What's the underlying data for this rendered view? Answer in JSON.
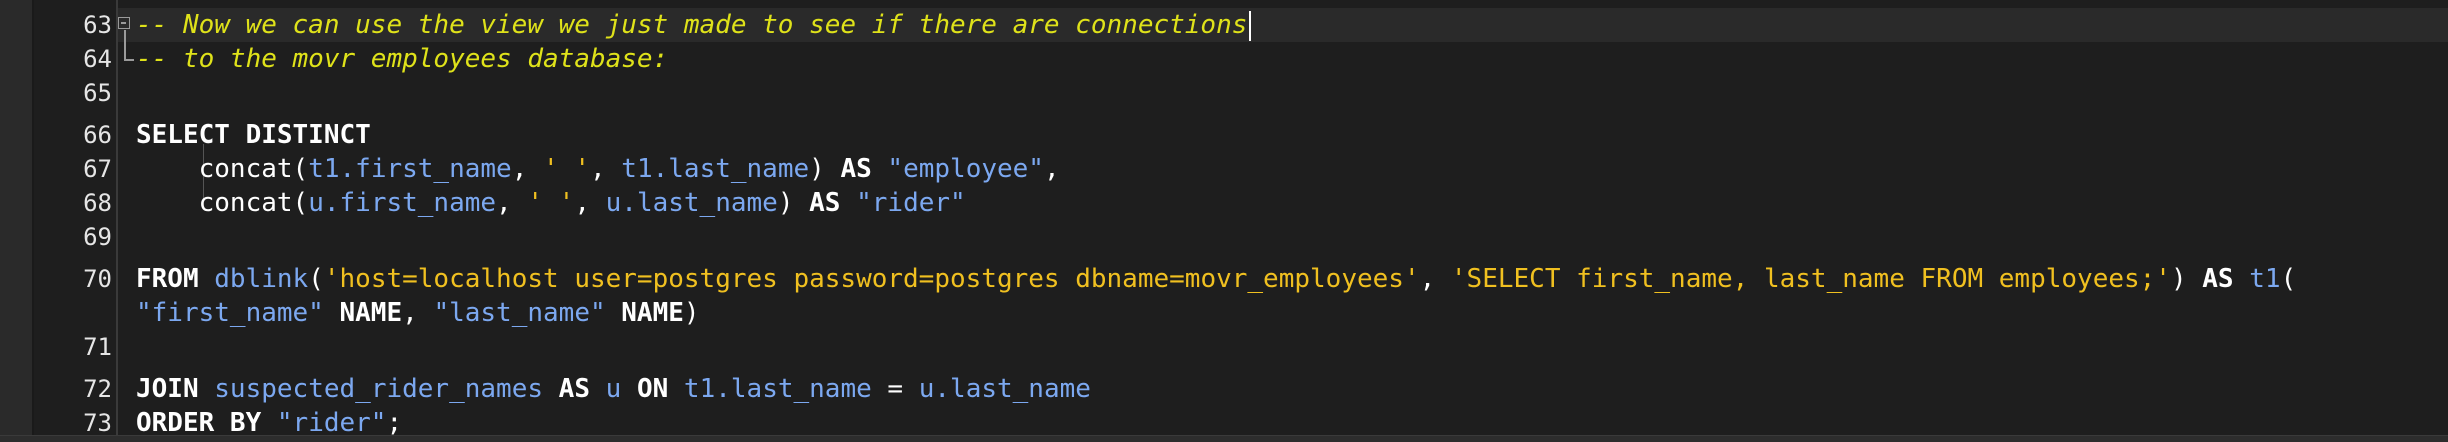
{
  "editor": {
    "lines": [
      {
        "no": "63",
        "segments": [
          {
            "t": "cm",
            "v": "-- Now we can use the view we just made to see if there are connections"
          }
        ]
      },
      {
        "no": "64",
        "segments": [
          {
            "t": "cm",
            "v": "-- to the movr employees database:"
          }
        ]
      },
      {
        "no": "65",
        "segments": []
      },
      {
        "no": "66",
        "segments": [
          {
            "t": "kw",
            "v": "SELECT DISTINCT"
          }
        ]
      },
      {
        "no": "67",
        "segments": [
          {
            "t": "pn",
            "v": "    "
          },
          {
            "t": "fn",
            "v": "concat"
          },
          {
            "t": "pn",
            "v": "("
          },
          {
            "t": "id",
            "v": "t1.first_name"
          },
          {
            "t": "pn",
            "v": ", "
          },
          {
            "t": "str",
            "v": "' '"
          },
          {
            "t": "pn",
            "v": ", "
          },
          {
            "t": "id",
            "v": "t1.last_name"
          },
          {
            "t": "pn",
            "v": ") "
          },
          {
            "t": "kw",
            "v": "AS "
          },
          {
            "t": "qid",
            "v": "\"employee\""
          },
          {
            "t": "pn",
            "v": ","
          }
        ]
      },
      {
        "no": "68",
        "segments": [
          {
            "t": "pn",
            "v": "    "
          },
          {
            "t": "fn",
            "v": "concat"
          },
          {
            "t": "pn",
            "v": "("
          },
          {
            "t": "id",
            "v": "u.first_name"
          },
          {
            "t": "pn",
            "v": ", "
          },
          {
            "t": "str",
            "v": "' '"
          },
          {
            "t": "pn",
            "v": ", "
          },
          {
            "t": "id",
            "v": "u.last_name"
          },
          {
            "t": "pn",
            "v": ") "
          },
          {
            "t": "kw",
            "v": "AS "
          },
          {
            "t": "qid",
            "v": "\"rider\""
          }
        ]
      },
      {
        "no": "69",
        "segments": []
      },
      {
        "no": "70",
        "segments": [
          {
            "t": "kw",
            "v": "FROM "
          },
          {
            "t": "id",
            "v": "dblink"
          },
          {
            "t": "pn",
            "v": "("
          },
          {
            "t": "str",
            "v": "'host=localhost user=postgres password=postgres dbname=movr_employees'"
          },
          {
            "t": "pn",
            "v": ", "
          },
          {
            "t": "str",
            "v": "'SELECT first_name, last_name FROM employees;'"
          },
          {
            "t": "pn",
            "v": ") "
          },
          {
            "t": "kw",
            "v": "AS "
          },
          {
            "t": "id",
            "v": "t1"
          },
          {
            "t": "pn",
            "v": "("
          }
        ]
      },
      {
        "no": "",
        "segments": [
          {
            "t": "qid",
            "v": "\"first_name\""
          },
          {
            "t": "kw",
            "v": " NAME"
          },
          {
            "t": "pn",
            "v": ", "
          },
          {
            "t": "qid",
            "v": "\"last_name\""
          },
          {
            "t": "kw",
            "v": " NAME"
          },
          {
            "t": "pn",
            "v": ")"
          }
        ]
      },
      {
        "no": "71",
        "segments": []
      },
      {
        "no": "72",
        "segments": [
          {
            "t": "kw",
            "v": "JOIN "
          },
          {
            "t": "id",
            "v": "suspected_rider_names"
          },
          {
            "t": "kw",
            "v": " AS "
          },
          {
            "t": "id",
            "v": "u"
          },
          {
            "t": "kw",
            "v": " ON "
          },
          {
            "t": "id",
            "v": "t1.last_name"
          },
          {
            "t": "pn",
            "v": " = "
          },
          {
            "t": "id",
            "v": "u.last_name"
          }
        ]
      },
      {
        "no": "73",
        "segments": [
          {
            "t": "kw",
            "v": "ORDER BY "
          },
          {
            "t": "qid",
            "v": "\"rider\""
          },
          {
            "t": "pn",
            "v": ";"
          }
        ]
      }
    ]
  }
}
